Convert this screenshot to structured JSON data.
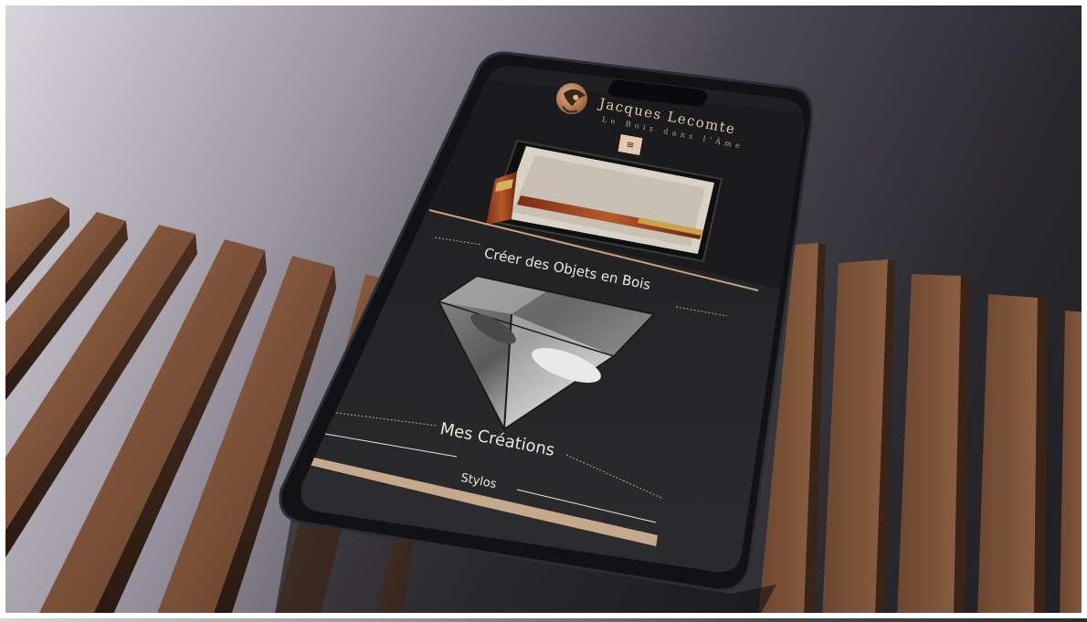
{
  "site": {
    "brand_name": "Jacques Lecomte",
    "tagline": "Le Bois dans l'Âme",
    "menu_icon": "hamburger-icon"
  },
  "sections": {
    "create_heading": "Créer des Objets en Bois",
    "creations_heading": "Mes Créations",
    "pens_heading": "Stylos"
  },
  "colors": {
    "accent": "#c9a27e",
    "screen_bg": "#2a2a2c",
    "text": "#efe6da",
    "wood": "#7a5238"
  }
}
